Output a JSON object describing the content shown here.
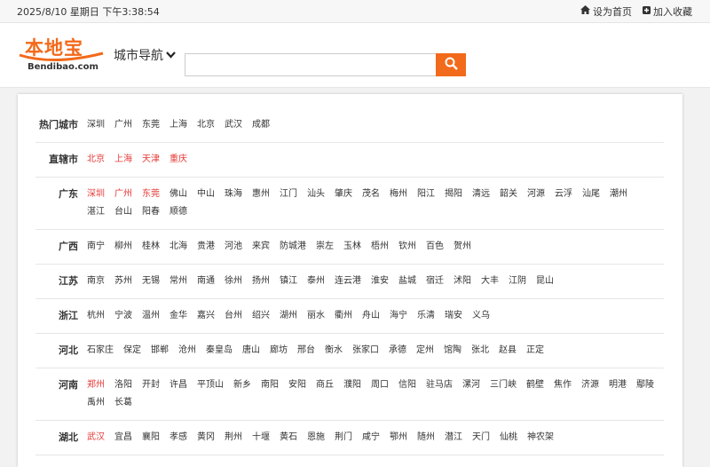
{
  "topbar": {
    "datetime": "2025/8/10 星期日 下午3:38:54",
    "set_home": "设为首页",
    "add_fav": "加入收藏"
  },
  "header": {
    "logo_cn": "本地宝",
    "logo_en": "Bendibao.com",
    "city_nav": "城市导航",
    "search_placeholder": "",
    "accent": "#f26a1b"
  },
  "rows": [
    {
      "name": "热门城市",
      "cities": [
        [
          "深圳",
          0
        ],
        [
          "广州",
          0
        ],
        [
          "东莞",
          0
        ],
        [
          "上海",
          0
        ],
        [
          "北京",
          0
        ],
        [
          "武汉",
          0
        ],
        [
          "成都",
          0
        ]
      ]
    },
    {
      "name": "直辖市",
      "cities": [
        [
          "北京",
          1
        ],
        [
          "上海",
          1
        ],
        [
          "天津",
          1
        ],
        [
          "重庆",
          1
        ]
      ]
    },
    {
      "name": "广东",
      "cities": [
        [
          "深圳",
          1
        ],
        [
          "广州",
          1
        ],
        [
          "东莞",
          1
        ],
        [
          "佛山",
          0
        ],
        [
          "中山",
          0
        ],
        [
          "珠海",
          0
        ],
        [
          "惠州",
          0
        ],
        [
          "江门",
          0
        ],
        [
          "汕头",
          0
        ],
        [
          "肇庆",
          0
        ],
        [
          "茂名",
          0
        ],
        [
          "梅州",
          0
        ],
        [
          "阳江",
          0
        ],
        [
          "揭阳",
          0
        ],
        [
          "清远",
          0
        ],
        [
          "韶关",
          0
        ],
        [
          "河源",
          0
        ],
        [
          "云浮",
          0
        ],
        [
          "汕尾",
          0
        ],
        [
          "潮州",
          0
        ],
        [
          "湛江",
          0
        ],
        [
          "台山",
          0
        ],
        [
          "阳春",
          0
        ],
        [
          "顺德",
          0
        ]
      ]
    },
    {
      "name": "广西",
      "cities": [
        [
          "南宁",
          0
        ],
        [
          "柳州",
          0
        ],
        [
          "桂林",
          0
        ],
        [
          "北海",
          0
        ],
        [
          "贵港",
          0
        ],
        [
          "河池",
          0
        ],
        [
          "来宾",
          0
        ],
        [
          "防城港",
          0
        ],
        [
          "崇左",
          0
        ],
        [
          "玉林",
          0
        ],
        [
          "梧州",
          0
        ],
        [
          "钦州",
          0
        ],
        [
          "百色",
          0
        ],
        [
          "贺州",
          0
        ]
      ]
    },
    {
      "name": "江苏",
      "cities": [
        [
          "南京",
          0
        ],
        [
          "苏州",
          0
        ],
        [
          "无锡",
          0
        ],
        [
          "常州",
          0
        ],
        [
          "南通",
          0
        ],
        [
          "徐州",
          0
        ],
        [
          "扬州",
          0
        ],
        [
          "镇江",
          0
        ],
        [
          "泰州",
          0
        ],
        [
          "连云港",
          0
        ],
        [
          "淮安",
          0
        ],
        [
          "盐城",
          0
        ],
        [
          "宿迁",
          0
        ],
        [
          "沭阳",
          0
        ],
        [
          "大丰",
          0
        ],
        [
          "江阴",
          0
        ],
        [
          "昆山",
          0
        ]
      ]
    },
    {
      "name": "浙江",
      "cities": [
        [
          "杭州",
          0
        ],
        [
          "宁波",
          0
        ],
        [
          "温州",
          0
        ],
        [
          "金华",
          0
        ],
        [
          "嘉兴",
          0
        ],
        [
          "台州",
          0
        ],
        [
          "绍兴",
          0
        ],
        [
          "湖州",
          0
        ],
        [
          "丽水",
          0
        ],
        [
          "衢州",
          0
        ],
        [
          "舟山",
          0
        ],
        [
          "海宁",
          0
        ],
        [
          "乐清",
          0
        ],
        [
          "瑞安",
          0
        ],
        [
          "义乌",
          0
        ]
      ]
    },
    {
      "name": "河北",
      "cities": [
        [
          "石家庄",
          0
        ],
        [
          "保定",
          0
        ],
        [
          "邯郸",
          0
        ],
        [
          "沧州",
          0
        ],
        [
          "秦皇岛",
          0
        ],
        [
          "唐山",
          0
        ],
        [
          "廊坊",
          0
        ],
        [
          "邢台",
          0
        ],
        [
          "衡水",
          0
        ],
        [
          "张家口",
          0
        ],
        [
          "承德",
          0
        ],
        [
          "定州",
          0
        ],
        [
          "馆陶",
          0
        ],
        [
          "张北",
          0
        ],
        [
          "赵县",
          0
        ],
        [
          "正定",
          0
        ]
      ]
    },
    {
      "name": "河南",
      "cities": [
        [
          "郑州",
          1
        ],
        [
          "洛阳",
          0
        ],
        [
          "开封",
          0
        ],
        [
          "许昌",
          0
        ],
        [
          "平顶山",
          0
        ],
        [
          "新乡",
          0
        ],
        [
          "南阳",
          0
        ],
        [
          "安阳",
          0
        ],
        [
          "商丘",
          0
        ],
        [
          "濮阳",
          0
        ],
        [
          "周口",
          0
        ],
        [
          "信阳",
          0
        ],
        [
          "驻马店",
          0
        ],
        [
          "漯河",
          0
        ],
        [
          "三门峡",
          0
        ],
        [
          "鹤壁",
          0
        ],
        [
          "焦作",
          0
        ],
        [
          "济源",
          0
        ],
        [
          "明港",
          0
        ],
        [
          "鄢陵",
          0
        ],
        [
          "禹州",
          0
        ],
        [
          "长葛",
          0
        ]
      ]
    },
    {
      "name": "湖北",
      "cities": [
        [
          "武汉",
          1
        ],
        [
          "宜昌",
          0
        ],
        [
          "襄阳",
          0
        ],
        [
          "孝感",
          0
        ],
        [
          "黄冈",
          0
        ],
        [
          "荆州",
          0
        ],
        [
          "十堰",
          0
        ],
        [
          "黄石",
          0
        ],
        [
          "恩施",
          0
        ],
        [
          "荆门",
          0
        ],
        [
          "咸宁",
          0
        ],
        [
          "鄂州",
          0
        ],
        [
          "随州",
          0
        ],
        [
          "潜江",
          0
        ],
        [
          "天门",
          0
        ],
        [
          "仙桃",
          0
        ],
        [
          "神农架",
          0
        ]
      ]
    }
  ]
}
